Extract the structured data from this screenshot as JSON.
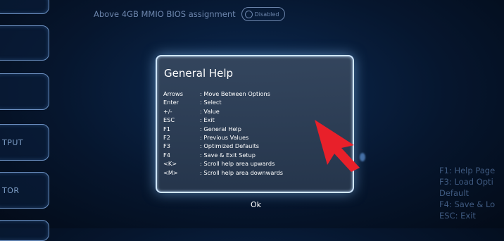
{
  "top_setting": {
    "label": "Above 4GB MMIO BIOS assignment",
    "toggle_state": "Disabled"
  },
  "left_tabs": [
    {
      "label": ""
    },
    {
      "label": ""
    },
    {
      "label": ""
    },
    {
      "label": "TPUT"
    },
    {
      "label": "TOR"
    },
    {
      "label": ""
    }
  ],
  "dialog": {
    "title": "General Help",
    "items": [
      {
        "key": "Arrows",
        "desc": ": Move Between Options"
      },
      {
        "key": "Enter",
        "desc": ": Select"
      },
      {
        "key": "+/-",
        "desc": ": Value"
      },
      {
        "key": "ESC",
        "desc": ": Exit"
      },
      {
        "key": "F1",
        "desc": ": General Help"
      },
      {
        "key": "F2",
        "desc": ": Previous Values"
      },
      {
        "key": "F3",
        "desc": ": Optimized Defaults"
      },
      {
        "key": "F4",
        "desc": ": Save & Exit Setup"
      },
      {
        "key": "<K>",
        "desc": ": Scroll help area upwards"
      },
      {
        "key": "<M>",
        "desc": ": Scroll help area downwards"
      }
    ],
    "ok_label": "Ok"
  },
  "side_help": [
    "F1: Help Page",
    "F3: Load Opti",
    "Default",
    "F4: Save & Lo",
    "ESC: Exit"
  ],
  "colors": {
    "background": "#06162e",
    "dialog_border": "#cfe6ff",
    "arrow": "#e8202a"
  }
}
